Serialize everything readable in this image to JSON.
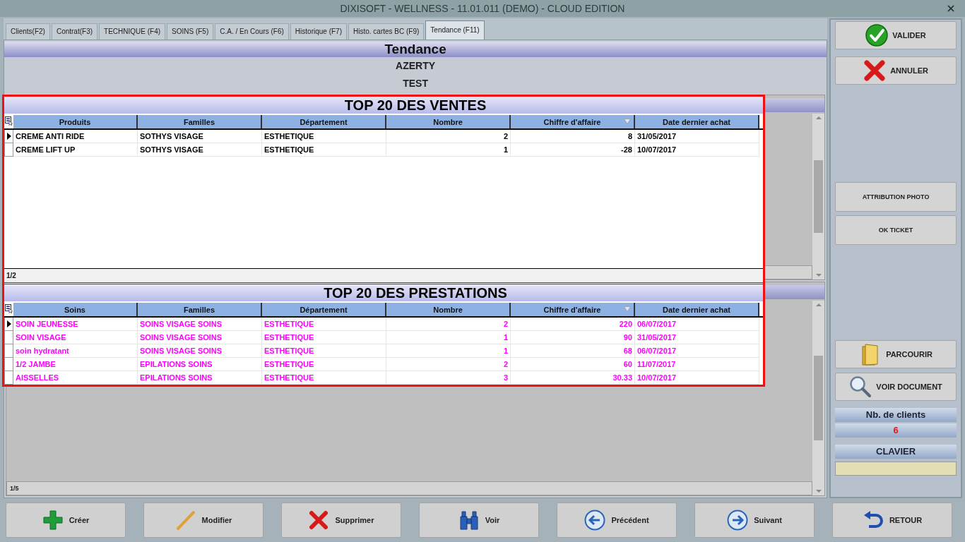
{
  "window": {
    "title": "DIXISOFT - WELLNESS - 11.01.011 (DEMO) - CLOUD EDITION"
  },
  "tabs": [
    {
      "label": "Clients(F2)",
      "selected": false
    },
    {
      "label": "Contrat(F3)",
      "selected": false
    },
    {
      "label": "TECHNIQUE (F4)",
      "selected": false
    },
    {
      "label": "SOINS (F5)",
      "selected": false
    },
    {
      "label": "C.A. / En Cours (F6)",
      "selected": false
    },
    {
      "label": "Historique (F7)",
      "selected": false
    },
    {
      "label": "Histo. cartes BC (F9)",
      "selected": false
    },
    {
      "label": "Tendance (F11)",
      "selected": true
    }
  ],
  "page": {
    "title": "Tendance",
    "lines": [
      "AZERTY",
      "TEST"
    ]
  },
  "background_grid": {
    "footer": "1/5"
  },
  "panels": [
    {
      "title": "TOP 20 DES VENTES",
      "color": "#000000",
      "columns": [
        {
          "label": "Produits",
          "kind": "text",
          "sorted": false
        },
        {
          "label": "Familles",
          "kind": "text",
          "sorted": false
        },
        {
          "label": "Département",
          "kind": "text",
          "sorted": false
        },
        {
          "label": "Nombre",
          "kind": "number",
          "sorted": false
        },
        {
          "label": "Chiffre d'affaire",
          "kind": "number",
          "sorted": true
        },
        {
          "label": "Date dernier achat",
          "kind": "text",
          "sorted": false
        }
      ],
      "rows": [
        {
          "selected": true,
          "cells": [
            "CREME ANTI RIDE",
            "SOTHYS VISAGE",
            "ESTHETIQUE",
            "2",
            "8",
            "31/05/2017"
          ]
        },
        {
          "selected": false,
          "cells": [
            "CREME LIFT UP",
            "SOTHYS VISAGE",
            "ESTHETIQUE",
            "1",
            "-28",
            "10/07/2017"
          ]
        }
      ],
      "footer": "1/2"
    },
    {
      "title": "TOP 20 DES PRESTATIONS",
      "color": "#ff00ff",
      "columns": [
        {
          "label": "Soins",
          "kind": "text",
          "sorted": false
        },
        {
          "label": "Familles",
          "kind": "text",
          "sorted": false
        },
        {
          "label": "Département",
          "kind": "text",
          "sorted": false
        },
        {
          "label": "Nombre",
          "kind": "number",
          "sorted": false
        },
        {
          "label": "Chiffre d'affaire",
          "kind": "number",
          "sorted": true
        },
        {
          "label": "Date dernier achat",
          "kind": "text",
          "sorted": false
        }
      ],
      "rows": [
        {
          "selected": true,
          "cells": [
            "SOIN JEUNESSE",
            "SOINS VISAGE SOINS",
            "ESTHETIQUE",
            "2",
            "220",
            "06/07/2017"
          ]
        },
        {
          "selected": false,
          "cells": [
            "SOIN VISAGE",
            "SOINS VISAGE SOINS",
            "ESTHETIQUE",
            "1",
            "90",
            "31/05/2017"
          ]
        },
        {
          "selected": false,
          "cells": [
            "soin hydratant",
            "SOINS VISAGE SOINS",
            "ESTHETIQUE",
            "1",
            "68",
            "06/07/2017"
          ]
        },
        {
          "selected": false,
          "cells": [
            "1/2 JAMBE",
            "EPILATIONS SOINS",
            "ESTHETIQUE",
            "2",
            "60",
            "11/07/2017"
          ]
        },
        {
          "selected": false,
          "cells": [
            "AISSELLES",
            "EPILATIONS SOINS",
            "ESTHETIQUE",
            "3",
            "30.33",
            "10/07/2017"
          ]
        }
      ]
    }
  ],
  "side_panel": {
    "top_buttons": [
      "VALIDER",
      "ANNULER"
    ],
    "middle_buttons": [
      "ATTRIBUTION PHOTO",
      "OK TICKET"
    ],
    "file_buttons": [
      "PARCOURIR",
      "VOIR DOCUMENT"
    ],
    "clients_label": "Nb. de clients",
    "clients_count": "6",
    "keyboard_label": "CLAVIER"
  },
  "toolbar": [
    "Créer",
    "Modifier",
    "Supprimer",
    "Voir",
    "Précédent",
    "Suivant",
    "RETOUR"
  ]
}
